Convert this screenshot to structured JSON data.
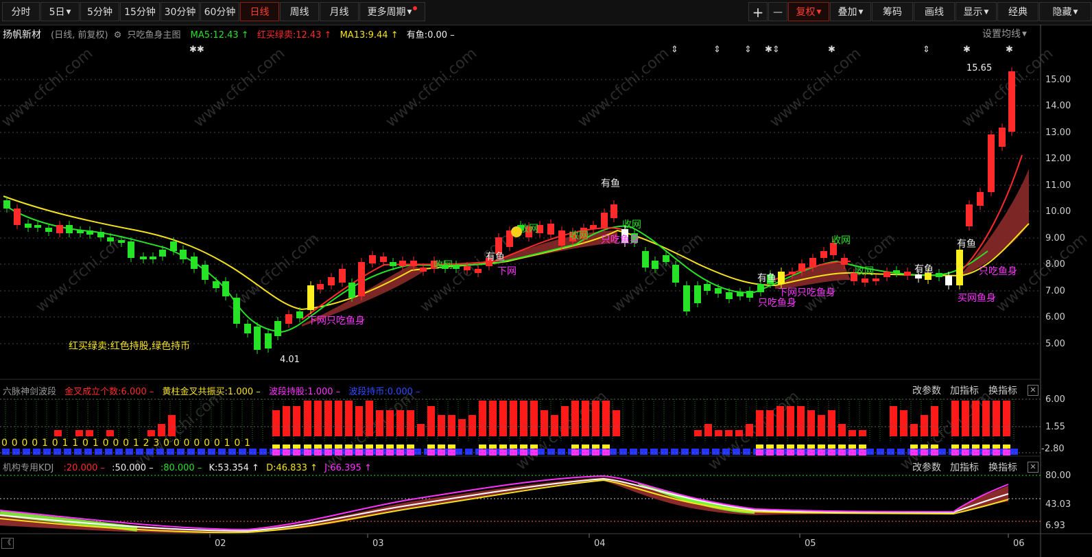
{
  "toolbar": {
    "left_tabs": [
      {
        "label": "分时",
        "active": false
      },
      {
        "label": "5日",
        "active": false,
        "dropdown": true
      },
      {
        "label": "5分钟",
        "active": false
      },
      {
        "label": "15分钟",
        "active": false
      },
      {
        "label": "30分钟",
        "active": false
      },
      {
        "label": "60分钟",
        "active": false
      },
      {
        "label": "日线",
        "active": true
      },
      {
        "label": "周线",
        "active": false
      },
      {
        "label": "月线",
        "active": false
      },
      {
        "label": "更多周期",
        "active": false,
        "dropdown": true
      }
    ],
    "zoom_in": "+",
    "zoom_out": "—",
    "right_tabs": [
      {
        "label": "复权",
        "active": true,
        "dropdown": true
      },
      {
        "label": "叠加",
        "dropdown": true
      },
      {
        "label": "筹码"
      },
      {
        "label": "画线"
      },
      {
        "label": "显示",
        "dropdown": true
      },
      {
        "label": "经典"
      },
      {
        "label": "隐藏",
        "dropdown": true
      }
    ]
  },
  "main": {
    "stock_name": "扬帆新材",
    "period": "(日线, 前复权)",
    "indicator_name": "只吃鱼身主图",
    "ma5": "MA5:12.43",
    "hongmai": "红买绿卖:12.43",
    "ma13": "MA13:9.44",
    "youyu": "有鱼:0.00",
    "set_ma": "设置均线",
    "legend_text": "红买绿卖:红色持股,绿色持币",
    "low_label": "4.01",
    "high_label": "15.65",
    "y_ticks": [
      "15.00",
      "14.00",
      "13.00",
      "12.00",
      "11.00",
      "10.00",
      "9.00",
      "8.00",
      "7.00",
      "6.00",
      "5.00"
    ],
    "annotations": {
      "youyu": "有鱼",
      "shouwang": "收网",
      "xiawang": "下网",
      "xiawang_zcys": "下网只吃鱼身",
      "zcys": "只吃鱼身",
      "zcys2": "只吃鱼身",
      "maiwang": "买网鱼身"
    }
  },
  "panel2": {
    "title": "六脉神剑波段",
    "jincha": "金叉成立个数:6.000",
    "huangzhu": "黄柱金叉共振买:1.000",
    "boduan_gu": "波段持股:1.000",
    "boduan_bi": "波段持币:0.000",
    "y_ticks": [
      "6.00",
      "1.55",
      "-2.80"
    ],
    "digits": "0 0 0 0 1 0 1 1 0 1 0 0 0 1 2 3 0 0 0 0 0 0 1 0 1"
  },
  "panel3": {
    "title": "机构专用KDJ",
    "l20": ":20.000",
    "l50": ":50.000",
    "l80": ":80.000",
    "k": "K:53.354",
    "d": "D:46.833",
    "j": "J:66.395",
    "y_ticks": [
      "80.00",
      "43.03",
      "6.93"
    ]
  },
  "panel_buttons": {
    "params": "改参数",
    "add": "加指标",
    "swap": "换指标",
    "close": "✕"
  },
  "x_axis": {
    "labels": [
      "02",
      "03",
      "04",
      "05",
      "06"
    ],
    "scroll_left": "《"
  },
  "watermark": "www.cfchi.com",
  "colors": {
    "up": "#ff2a2a",
    "down": "#27e327",
    "ma5": "#27e327",
    "ma13": "#f5e21a",
    "band": "#8b2a2a"
  }
}
